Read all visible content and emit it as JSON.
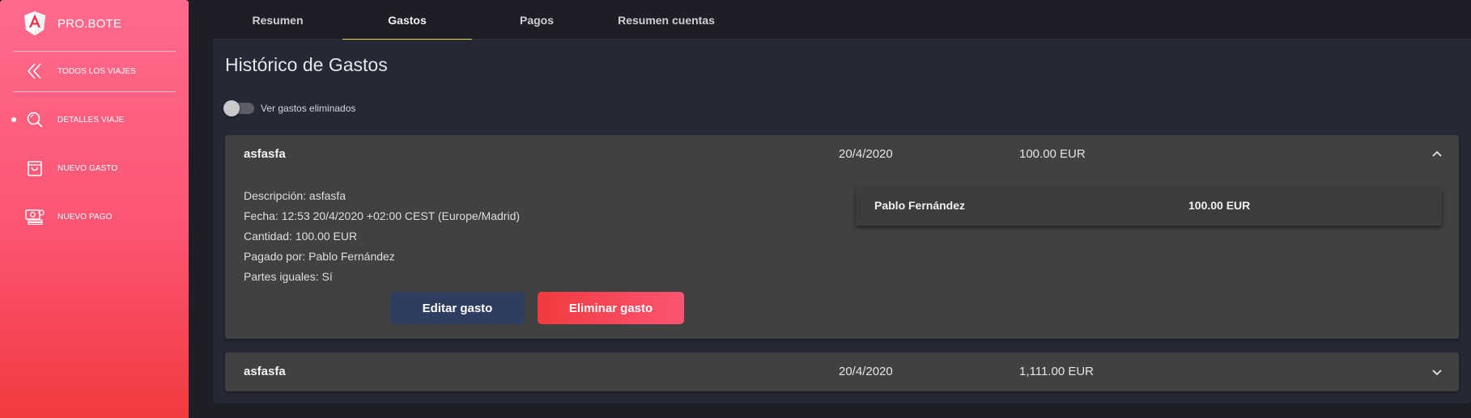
{
  "sidebar": {
    "brand": "PRO.BOTE",
    "items": [
      {
        "label": "TODOS LOS VIAJES",
        "icon": "double-chevron-left-icon"
      },
      {
        "label": "DETALLES VIAJE",
        "icon": "search-icon",
        "active": true
      },
      {
        "label": "NUEVO GASTO",
        "icon": "shopping-bag-icon"
      },
      {
        "label": "NUEVO PAGO",
        "icon": "money-icon"
      }
    ]
  },
  "tabs": [
    {
      "label": "Resumen"
    },
    {
      "label": "Gastos",
      "active": true
    },
    {
      "label": "Pagos"
    },
    {
      "label": "Resumen cuentas"
    }
  ],
  "main": {
    "title": "Histórico de Gastos",
    "toggle_label": "Ver gastos eliminados",
    "toggle_on": false,
    "expenses": [
      {
        "name": "asfasfa",
        "date": "20/4/2020",
        "amount": "100.00 EUR",
        "expanded": true,
        "details": [
          "Descripción: asfasfa",
          "Fecha: 12:53 20/4/2020 +02:00 CEST (Europe/Madrid)",
          "Cantidad: 100.00 EUR",
          "Pagado por: Pablo Fernández",
          "Partes iguales: Sí"
        ],
        "payer": {
          "name": "Pablo Fernández",
          "amount": "100.00 EUR"
        },
        "edit_label": "Editar gasto",
        "delete_label": "Eliminar gasto"
      },
      {
        "name": "asfasfa",
        "date": "20/4/2020",
        "amount": "1,111.00 EUR",
        "expanded": false
      }
    ]
  },
  "colors": {
    "sidebar_top": "#ff6a8c",
    "sidebar_bottom": "#f23a3e",
    "tab_indicator": "#e6d84a",
    "edit_button": "#2f3d60",
    "delete_button": "#f23a3e",
    "card_bg": "#414141",
    "panel_bg": "#262836"
  }
}
